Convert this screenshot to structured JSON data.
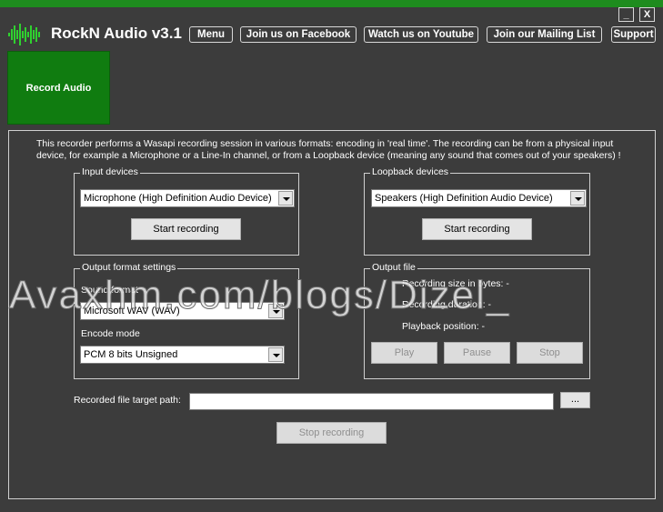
{
  "app": {
    "title": "RockN Audio v3.1",
    "accent_color": "#1e8c1e",
    "logo_icon": "waveform-logo-icon"
  },
  "window": {
    "minimize_label": "_",
    "close_label": "X"
  },
  "top_nav": {
    "menu": "Menu",
    "facebook": "Join us on Facebook",
    "youtube": "Watch us on Youtube",
    "mailing": "Join our Mailing List",
    "support": "Support"
  },
  "sidebar": {
    "record_audio": "Record Audio"
  },
  "main": {
    "intro": "This recorder performs a Wasapi recording session in various formats: encoding in 'real time'. The recording can be from a physical input device, for example a Microphone or a Line-In channel, or from a Loopback device (meaning any sound that comes out of your speakers) !",
    "input_devices": {
      "title": "Input devices",
      "selected": "Microphone (High Definition Audio Device)",
      "start_button": "Start recording"
    },
    "loopback_devices": {
      "title": "Loopback devices",
      "selected": "Speakers (High Definition Audio Device)",
      "start_button": "Start recording"
    },
    "output_format": {
      "title": "Output format settings",
      "sound_format_label": "Sound format",
      "sound_format_value": "Microsoft WAV (WAV)",
      "encode_mode_label": "Encode mode",
      "encode_mode_value": "PCM 8 bits Unsigned"
    },
    "output_file": {
      "title": "Output file",
      "recording_size": "Recording size in bytes: -",
      "recording_duration": "Recording duration: -",
      "playback_position": "Playback position: -",
      "play": "Play",
      "pause": "Pause",
      "stop": "Stop"
    },
    "target_path": {
      "label": "Recorded file target path:",
      "value": "",
      "browse": "..."
    },
    "stop_recording": "Stop recording"
  },
  "watermark": "Avaxhm.com/blogs/Dizel_"
}
